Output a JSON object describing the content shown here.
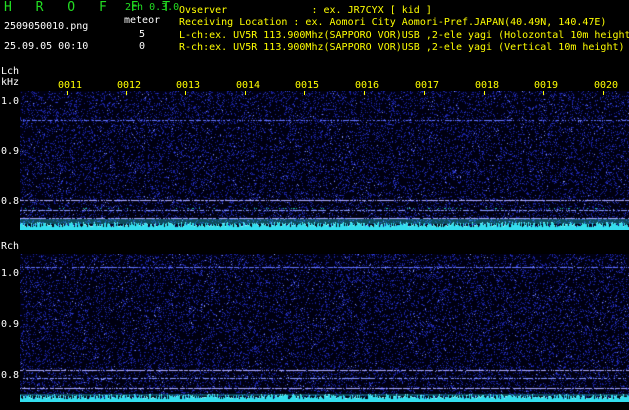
{
  "header": {
    "app_title": "H R O F F T",
    "filename": "2509050010.png",
    "datetime": "25.09.05 00:10",
    "mode": "2ch 0.3.0",
    "meteor_label": "meteor",
    "meteor_lch": "5",
    "meteor_rch": "0",
    "observer": "Ovserver              : ex. JR7CYX [ kid ]",
    "location": "Receiving Location : ex. Aomori City Aomori-Pref.JAPAN(40.49N, 140.47E)",
    "lch_info": "L-ch:ex. UV5R 113.900Mhz(SAPPORO VOR)USB ,2-ele yagi (Holozontal 10m height)",
    "rch_info": "R-ch:ex. UV5R 113.900Mhz(SAPPORO VOR)USB ,2-ele yagi (Vertical 10m height)"
  },
  "lch": {
    "label": "Lch",
    "unit": "kHz",
    "y_ticks": [
      "1.0",
      "0.9",
      "0.8"
    ]
  },
  "rch": {
    "label": "Rch",
    "y_ticks": [
      "1.0",
      "0.9",
      "0.8"
    ]
  },
  "time_ticks": [
    "0011",
    "0012",
    "0013",
    "0014",
    "0015",
    "0016",
    "0017",
    "0018",
    "0019",
    "0020"
  ],
  "colors": {
    "text_green": "#22dd22",
    "tick_yellow": "#ffff00",
    "noise_blue": "#2233cc",
    "signal_cyan": "#33ddee"
  }
}
